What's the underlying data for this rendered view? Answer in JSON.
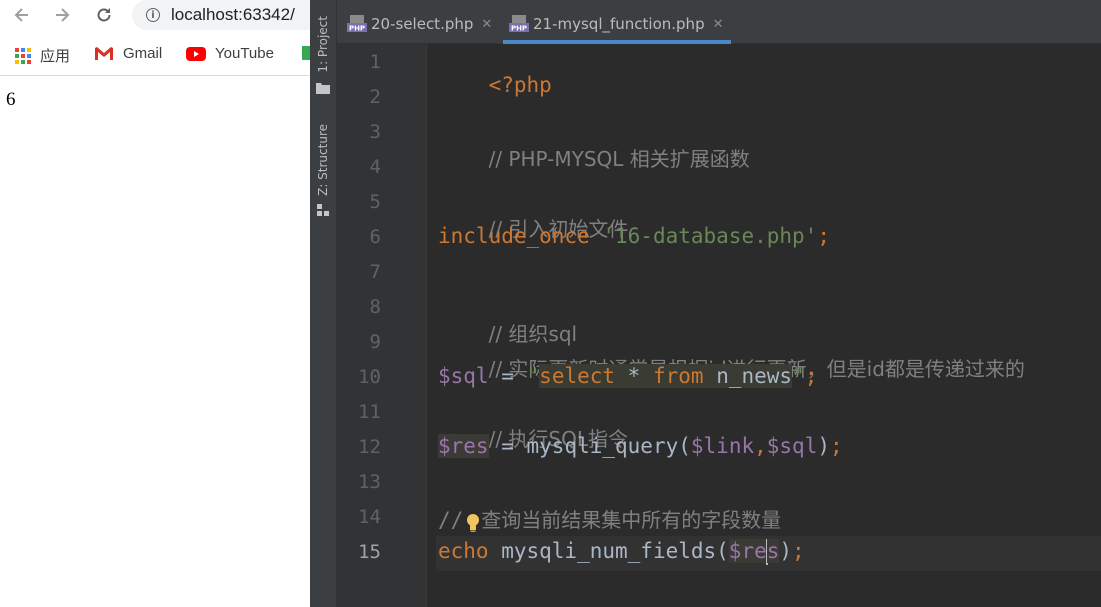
{
  "browser": {
    "url": "localhost:63342/",
    "bookmarks": [
      {
        "label": "应用",
        "icon": "apps-grid-icon"
      },
      {
        "label": "Gmail",
        "icon": "gmail-icon"
      },
      {
        "label": "YouTube",
        "icon": "youtube-icon"
      }
    ],
    "page_output": "6"
  },
  "ide": {
    "sidebar": {
      "project_label": "1: Project",
      "structure_label": "Z: Structure"
    },
    "tabs": [
      {
        "label": "20-select.php",
        "active": false
      },
      {
        "label": "21-mysql_function.php",
        "active": true
      }
    ],
    "current_line": 15,
    "lines": [
      {
        "n": "1"
      },
      {
        "n": "2"
      },
      {
        "n": "3"
      },
      {
        "n": "4"
      },
      {
        "n": "5"
      },
      {
        "n": "6"
      },
      {
        "n": "7"
      },
      {
        "n": "8"
      },
      {
        "n": "9"
      },
      {
        "n": "10"
      },
      {
        "n": "11"
      },
      {
        "n": "12"
      },
      {
        "n": "13"
      },
      {
        "n": "14"
      },
      {
        "n": "15"
      }
    ],
    "code": {
      "l1": "<?php",
      "l3": "// PHP-MYSQL 相关扩展函数",
      "l5": "// 引入初始文件",
      "l6_kw": "include_once",
      "l6_str": "'16-database.php'",
      "l6_end": ";",
      "l8": "// 组织sql",
      "l9": "// 实际更新时通常是根据id进行更新，但是id都是传递过来的",
      "l10_var": "$sql",
      "l10_eq": " = ",
      "l10_q1": "\"",
      "l10_select": "select",
      "l10_star": " * ",
      "l10_from": "from",
      "l10_table": " n_news",
      "l10_q2": "\"",
      "l10_end": ";",
      "l11": "// 执行SQL指令",
      "l12_var": "$res",
      "l12_eq": " = ",
      "l12_fn": "mysqli_query(",
      "l12_a1": "$link",
      "l12_comma": ",",
      "l12_a2": "$sql",
      "l12_close": ")",
      "l12_end": ";",
      "l14_slash": "//",
      "l14_text": "查询当前结果集中所有的字段数量",
      "l15_kw": "echo",
      "l15_fn": " mysqli_num_fields(",
      "l15_var_a": "$re",
      "l15_var_b": "s",
      "l15_close": ")",
      "l15_end": ";"
    },
    "colors": {
      "keyword": "#cc7832",
      "string": "#6a8759",
      "comment": "#808080",
      "variable": "#9876aa",
      "text": "#a9b7c6",
      "background": "#2b2b2b"
    }
  }
}
